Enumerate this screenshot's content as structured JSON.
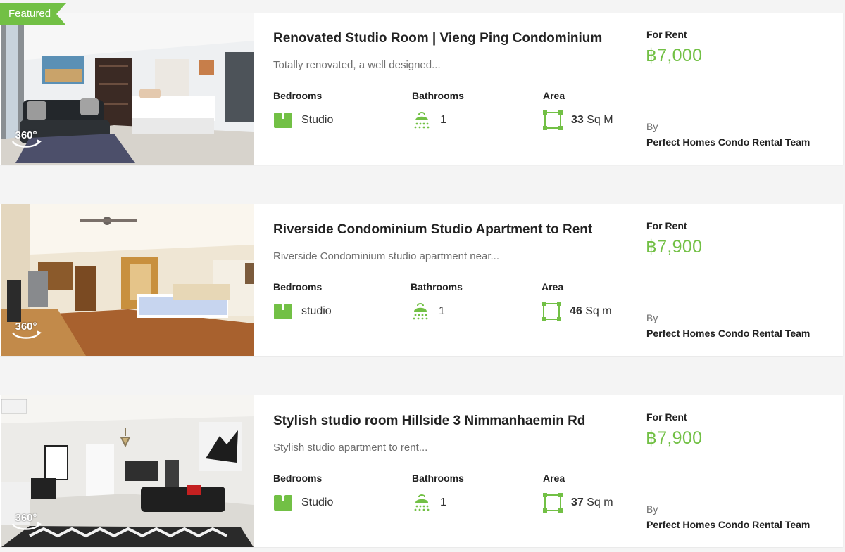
{
  "colors": {
    "accent": "#72c045",
    "price": "#72c045",
    "text": "#222222",
    "muted": "#6f6f6f",
    "background": "#f4f4f4"
  },
  "labels": {
    "bedrooms": "Bedrooms",
    "bathrooms": "Bathrooms",
    "area": "Area",
    "featured": "Featured",
    "vr": "360°",
    "by": "By"
  },
  "listings": [
    {
      "featured": true,
      "title": "Renovated Studio Room | Vieng Ping Condominium",
      "excerpt": "Totally renovated, a well designed...",
      "bedrooms": "Studio",
      "bathrooms": "1",
      "area_value": "33",
      "area_unit": "Sq M",
      "status": "For Rent",
      "price": "฿7,000",
      "agent": "Perfect Homes Condo Rental Team",
      "image_icon": "studio-room-photo",
      "has_360": true
    },
    {
      "featured": false,
      "title": "Riverside Condominium Studio Apartment to Rent",
      "excerpt": "Riverside Condominium studio apartment near...",
      "bedrooms": "studio",
      "bathrooms": "1",
      "area_value": "46",
      "area_unit": "Sq m",
      "status": "For Rent",
      "price": "฿7,900",
      "agent": "Perfect Homes Condo Rental Team",
      "image_icon": "riverside-room-photo",
      "has_360": true
    },
    {
      "featured": false,
      "title": "Stylish studio room Hillside 3 Nimmanhaemin Rd",
      "excerpt": "Stylish studio apartment to rent...",
      "bedrooms": "Studio",
      "bathrooms": "1",
      "area_value": "37",
      "area_unit": "Sq m",
      "status": "For Rent",
      "price": "฿7,900",
      "agent": "Perfect Homes Condo Rental Team",
      "image_icon": "hillside-room-photo",
      "has_360": true
    }
  ]
}
